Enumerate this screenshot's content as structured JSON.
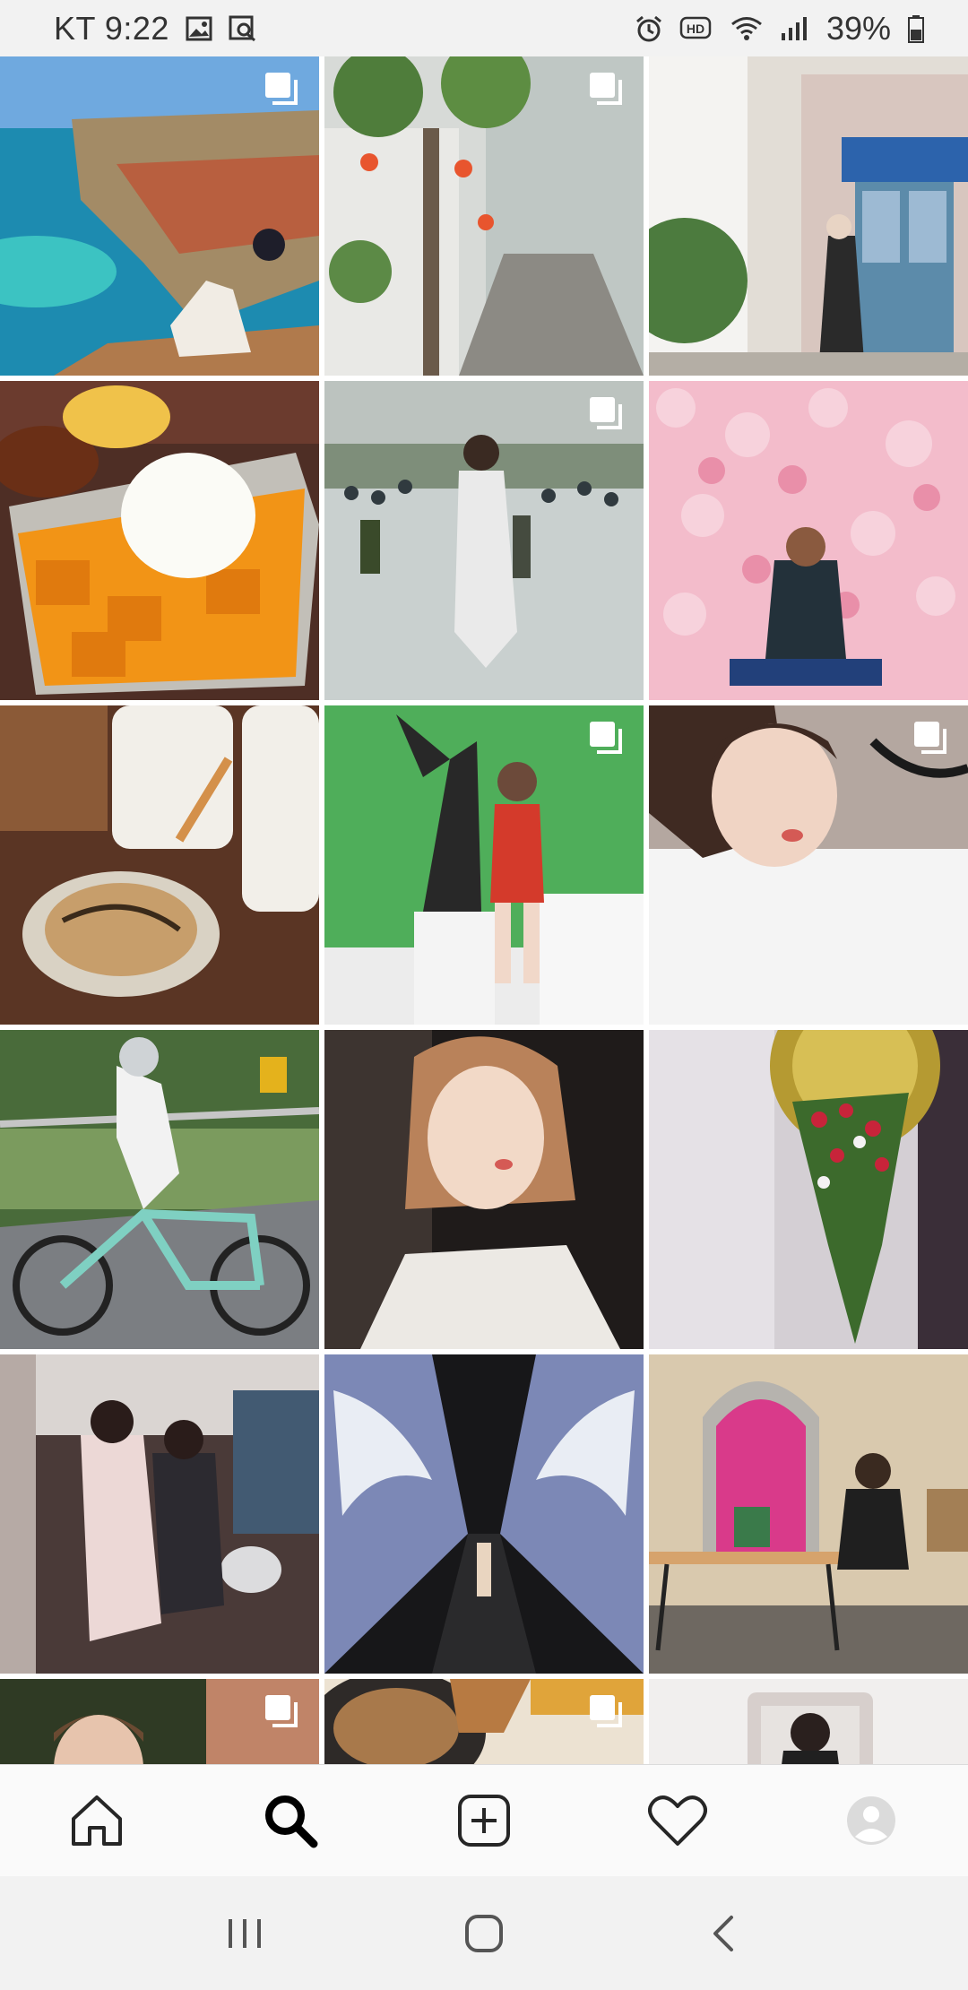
{
  "status_bar": {
    "carrier_time": "KT 9:22",
    "battery": "39%",
    "icons": [
      "gallery-icon",
      "screen-search-icon",
      "alarm-icon",
      "hd-voice-icon",
      "wifi-icon",
      "signal-icon",
      "battery-icon"
    ]
  },
  "grid": {
    "tiles": [
      {
        "description_name": "coastal-village-photo",
        "multi": true
      },
      {
        "description_name": "flower-alley-photo",
        "multi": true
      },
      {
        "description_name": "cafe-storefront-photo",
        "multi": false
      },
      {
        "description_name": "mango-bingsu-photo",
        "multi": false
      },
      {
        "description_name": "water-park-photo",
        "multi": true
      },
      {
        "description_name": "flower-wall-photo",
        "multi": false
      },
      {
        "description_name": "utensil-dessert-photo",
        "multi": false
      },
      {
        "description_name": "statue-green-wall-photo",
        "multi": true
      },
      {
        "description_name": "selfie-bed-photo",
        "multi": true
      },
      {
        "description_name": "cyclist-photo",
        "multi": false
      },
      {
        "description_name": "portrait-photo",
        "multi": false
      },
      {
        "description_name": "hanging-flowers-photo",
        "multi": false
      },
      {
        "description_name": "mirror-selfie-photo",
        "multi": false
      },
      {
        "description_name": "light-tunnel-photo",
        "multi": false
      },
      {
        "description_name": "pink-door-photo",
        "multi": false
      },
      {
        "description_name": "partial-portrait-photo",
        "multi": true
      },
      {
        "description_name": "partial-food-photo",
        "multi": true
      },
      {
        "description_name": "partial-mirror-photo",
        "multi": false
      }
    ]
  },
  "bottom_nav": {
    "items": [
      "home-icon",
      "search-icon",
      "new-post-icon",
      "activity-heart-icon",
      "profile-avatar-icon"
    ],
    "active": "search-icon"
  },
  "system_nav": {
    "items": [
      "recent-apps-icon",
      "home-button-icon",
      "back-icon"
    ]
  },
  "colors": {
    "status_bg": "#f2f2f2",
    "nav_bg": "#fafafa",
    "icon_dark": "#262626"
  }
}
